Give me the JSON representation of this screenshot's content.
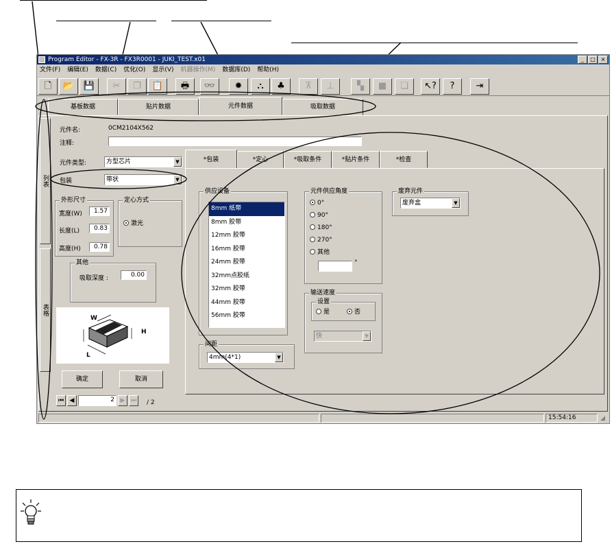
{
  "window": {
    "title": "Program Editor - FX-3R - FX3R0001 - JUKI_TEST.x01",
    "controls": [
      "_",
      "□",
      "×"
    ]
  },
  "menu": [
    {
      "label": "文件(F)",
      "enabled": true
    },
    {
      "label": "编辑(E)",
      "enabled": true
    },
    {
      "label": "数据(C)",
      "enabled": true
    },
    {
      "label": "优化(O)",
      "enabled": true
    },
    {
      "label": "显示(V)",
      "enabled": true
    },
    {
      "label": "机器操作(M)",
      "enabled": false
    },
    {
      "label": "数据库(D)",
      "enabled": true
    },
    {
      "label": "帮助(H)",
      "enabled": true
    }
  ],
  "toolbar_icons": [
    "new-icon",
    "open-icon",
    "save-icon",
    "cut-icon",
    "copy-icon",
    "paste-icon",
    "print-icon",
    "find-icon",
    "light-icon",
    "tool-icon",
    "component-icon",
    "align-icon",
    "distribute-icon",
    "grid-icon",
    "square-icon",
    "layer-icon",
    "help-pointer-icon",
    "help-icon",
    "exit-icon"
  ],
  "tabs": {
    "main": [
      "基板数据",
      "贴片数据",
      "元件数据",
      "吸取数据"
    ],
    "active_main": "元件数据",
    "sub": [
      "*包装",
      "*定心",
      "*吸取条件",
      "*贴片条件",
      "*检查"
    ],
    "active_sub": "*包装",
    "vertical": [
      "列表",
      "表格"
    ]
  },
  "form": {
    "part_name_label": "元件名:",
    "part_name_value": "0CM2104X562",
    "comment_label": "注释:",
    "comment_value": "",
    "part_type_label": "元件类型:",
    "part_type_value": "方型芯片",
    "package_label": "包装",
    "package_value": "带状"
  },
  "dimensions": {
    "title": "外形尺寸",
    "width_label": "宽度(W)",
    "width_value": "1.57",
    "length_label": "长度(L)",
    "length_value": "0.83",
    "height_label": "高度(H)",
    "height_value": "0.78"
  },
  "centering": {
    "title": "定心方式",
    "option": "激光"
  },
  "other": {
    "title": "其他",
    "pickup_depth_label": "吸取深度 :",
    "pickup_depth_value": "0.00"
  },
  "diagram_labels": {
    "w": "W",
    "h": "H",
    "l": "L"
  },
  "buttons": {
    "ok": "确定",
    "cancel": "取消"
  },
  "pager": {
    "current": "2",
    "total": "/ 2"
  },
  "feeder": {
    "title": "供应设备",
    "items": [
      "8mm 纸带",
      "8mm 胶带",
      "12mm 胶带",
      "16mm 胶带",
      "24mm 胶带",
      "32mm点胶纸",
      "32mm 胶带",
      "44mm 胶带",
      "56mm 胶带"
    ],
    "selected_index": 0
  },
  "pitch": {
    "title": "间距",
    "value": "4mm(4*1)"
  },
  "supply_angle": {
    "title": "元件供应角度",
    "options": [
      "0°",
      "90°",
      "180°",
      "270°",
      "其他"
    ],
    "selected_index": 0,
    "other_value": "",
    "unit": "°"
  },
  "discard": {
    "title": "废弃元件",
    "value": "废弃盒"
  },
  "feed_speed": {
    "title": "输送速度",
    "setting_title": "设置",
    "yes": "是",
    "no": "否",
    "selected": "否",
    "speed_value": "快"
  },
  "status": {
    "time": "15:54:16"
  }
}
